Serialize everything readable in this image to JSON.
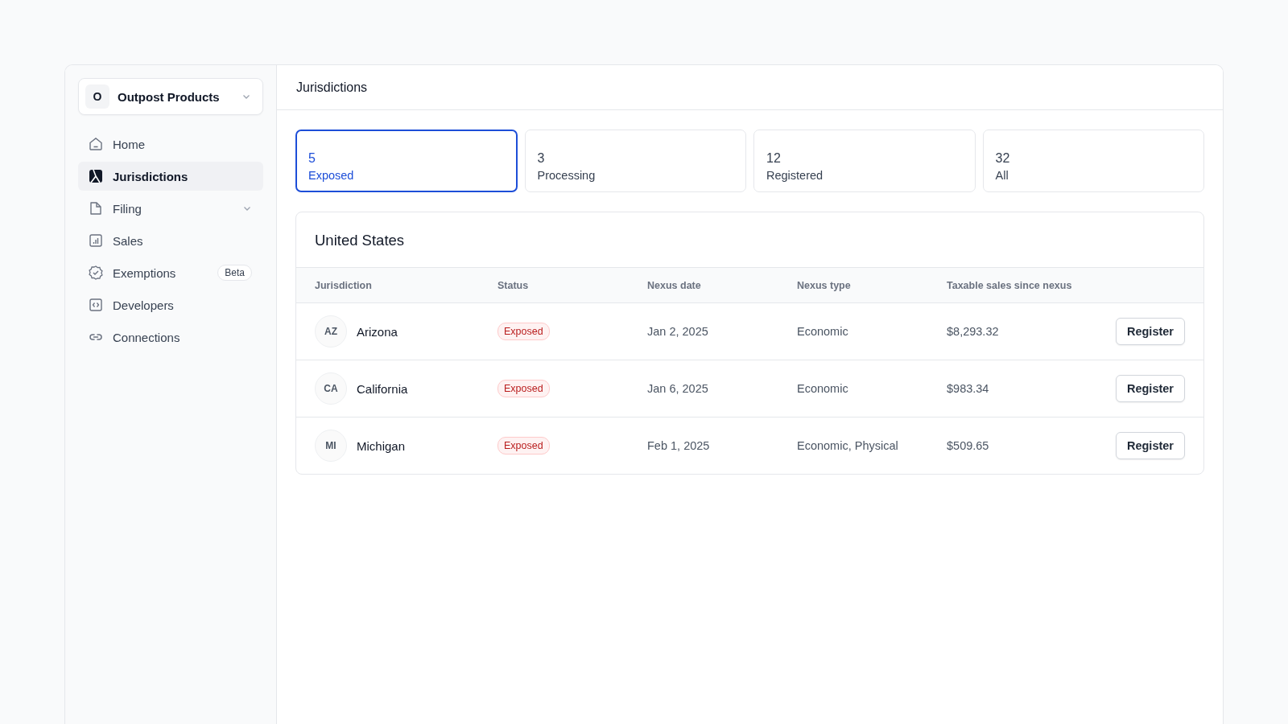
{
  "org_switcher": {
    "initial": "O",
    "name": "Outpost Products"
  },
  "sidebar": {
    "items": [
      {
        "label": "Home",
        "selected": false
      },
      {
        "label": "Jurisdictions",
        "selected": true
      },
      {
        "label": "Filing",
        "selected": false,
        "expanded": false
      },
      {
        "label": "Sales",
        "selected": false
      },
      {
        "label": "Exemptions",
        "selected": false,
        "badge": "Beta"
      },
      {
        "label": "Developers",
        "selected": false
      },
      {
        "label": "Connections",
        "selected": false
      }
    ]
  },
  "page_title": "Jurisdictions",
  "tabs": [
    {
      "count": "5",
      "label": "Exposed",
      "selected": true
    },
    {
      "count": "3",
      "label": "Processing",
      "selected": false
    },
    {
      "count": "12",
      "label": "Registered",
      "selected": false
    },
    {
      "count": "32",
      "label": "All",
      "selected": false
    }
  ],
  "section": {
    "title": "United States",
    "table": {
      "columns": [
        "Jurisdiction",
        "Status",
        "Nexus date",
        "Nexus type",
        "Taxable sales since nexus"
      ],
      "rows": [
        {
          "code": "AZ",
          "name": "Arizona",
          "status": "Exposed",
          "nexus_date": "Jan 2, 2025",
          "nexus_type": "Economic",
          "taxable_sales": "$8,293.32",
          "action": "Register"
        },
        {
          "code": "CA",
          "name": "California",
          "status": "Exposed",
          "nexus_date": "Jan 6, 2025",
          "nexus_type": "Economic",
          "taxable_sales": "$983.34",
          "action": "Register"
        },
        {
          "code": "MI",
          "name": "Michigan",
          "status": "Exposed",
          "nexus_date": "Feb 1, 2025",
          "nexus_type": "Economic, Physical",
          "taxable_sales": "$509.65",
          "action": "Register"
        }
      ]
    }
  }
}
